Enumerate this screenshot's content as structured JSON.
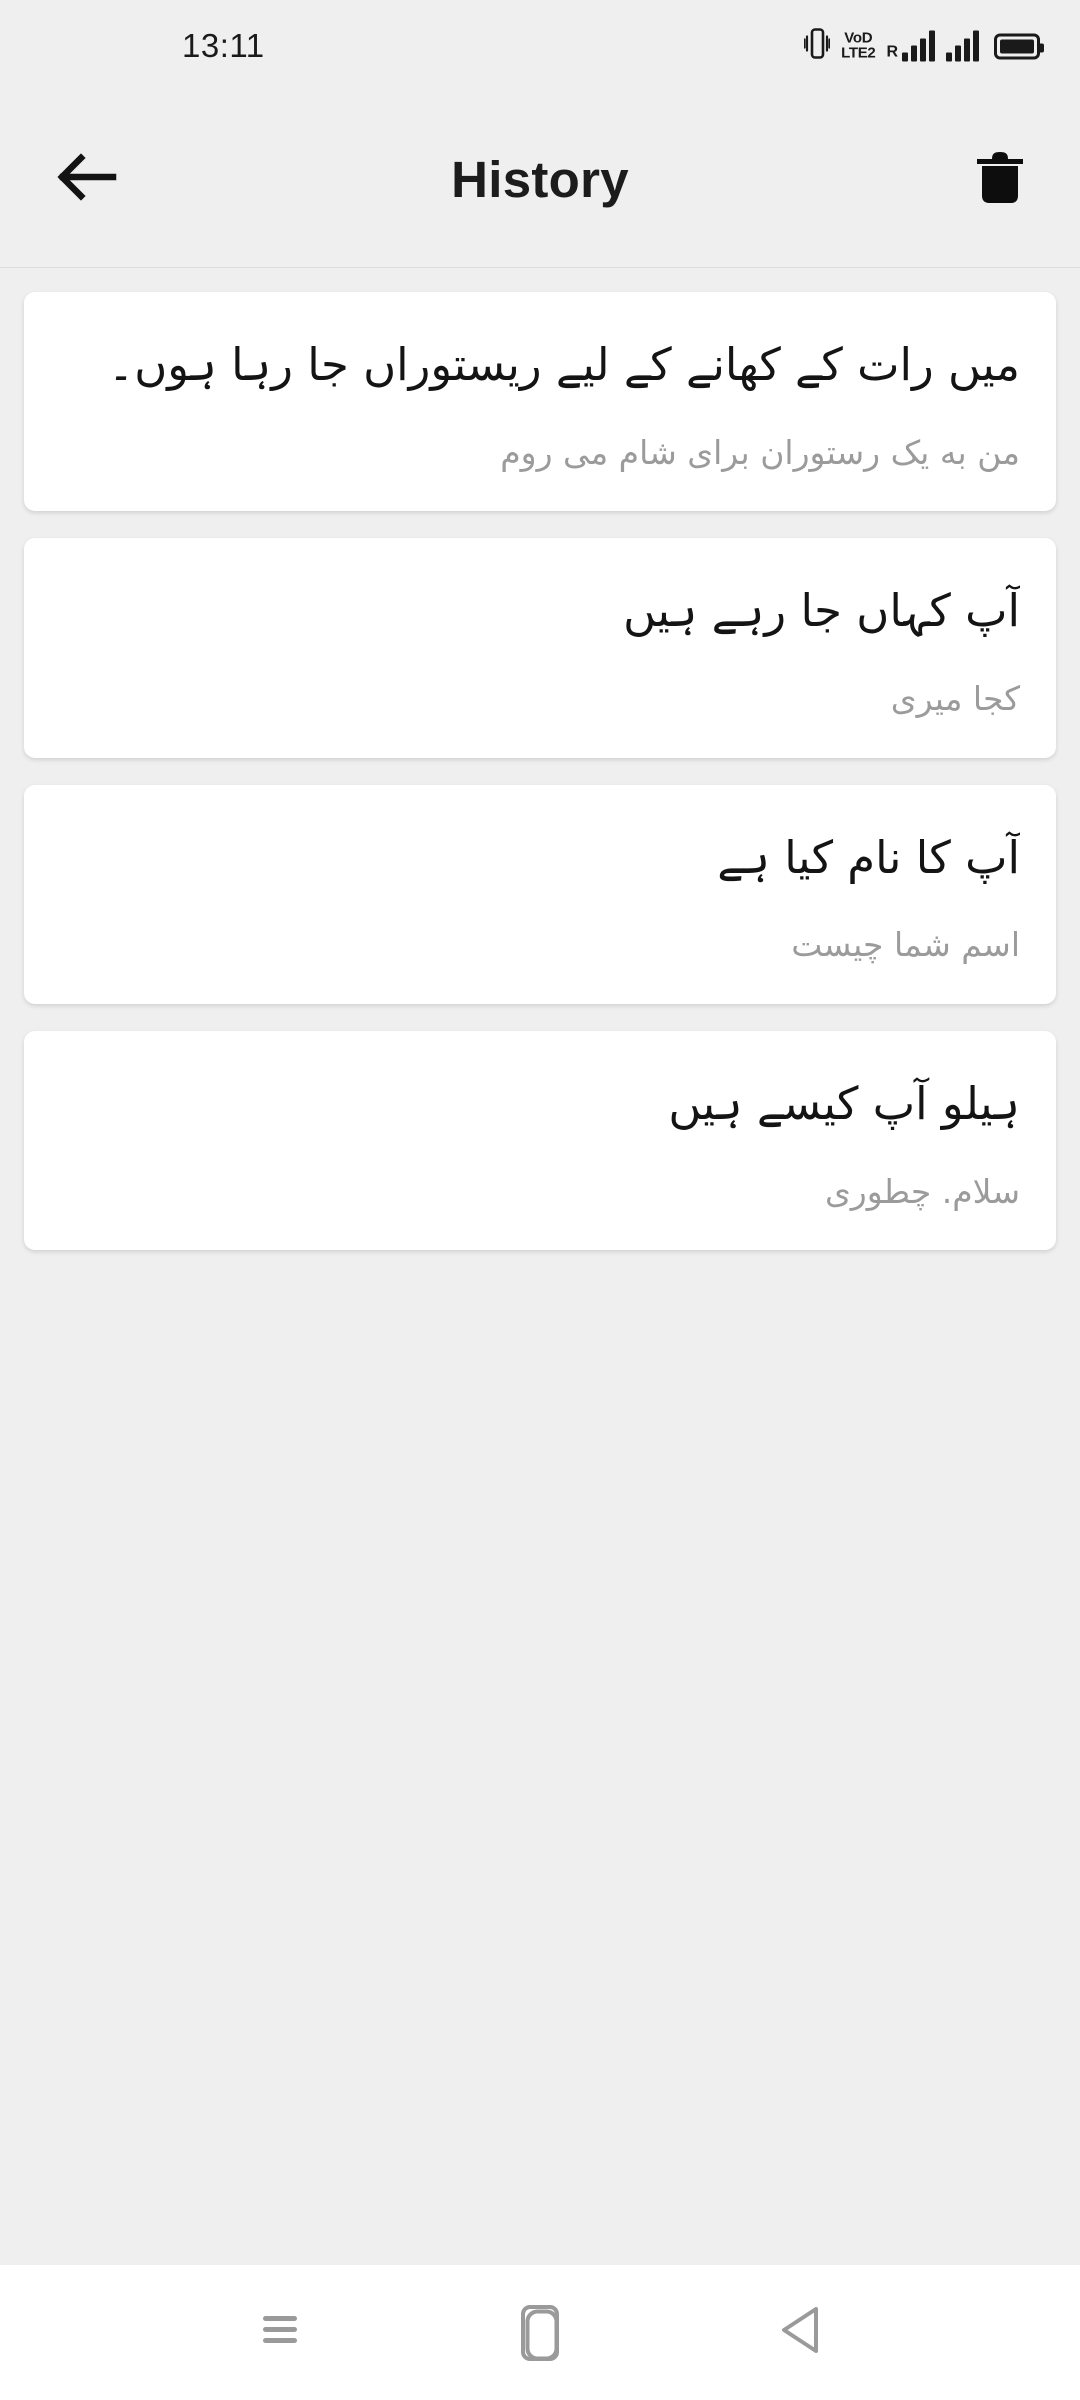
{
  "status_bar": {
    "clock": "13:11",
    "icons": [
      {
        "name": "vibrate-icon",
        "label": "vibrate"
      },
      {
        "name": "volte-icon",
        "line1": "VoD",
        "line2": "LTE2"
      },
      {
        "name": "roaming-icon",
        "label": "R"
      },
      {
        "name": "signal-sim1-icon",
        "label": "signal strength sim 1"
      },
      {
        "name": "signal-sim2-icon",
        "label": "signal strength sim 2"
      },
      {
        "name": "battery-icon",
        "label": "battery full"
      }
    ]
  },
  "app_bar": {
    "title": "History",
    "back_icon": "arrow-left-icon",
    "delete_icon": "trash-icon"
  },
  "history": {
    "items": [
      {
        "source": "میں رات کے کھانے کے لیے ریستوراں جا رہا ہوں۔",
        "target": "من به یک رستوران برای شام می روم"
      },
      {
        "source": "آپ کہاں جا رہے ہیں",
        "target": "کجا میری"
      },
      {
        "source": "آپ کا نام کیا ہے",
        "target": "اسم شما چیست"
      },
      {
        "source": "ہیلو آپ کیسے ہیں",
        "target": "سلام. چطوری"
      }
    ]
  },
  "nav_bar": {
    "recents_icon": "recents-icon",
    "home_icon": "home-icon",
    "back_icon": "nav-back-icon"
  },
  "colors": {
    "page_background": "#efefef",
    "card_background": "#ffffff",
    "primary_text": "#141414",
    "secondary_text": "#9b9b9b",
    "nav_icon": "#9a9a9a"
  }
}
